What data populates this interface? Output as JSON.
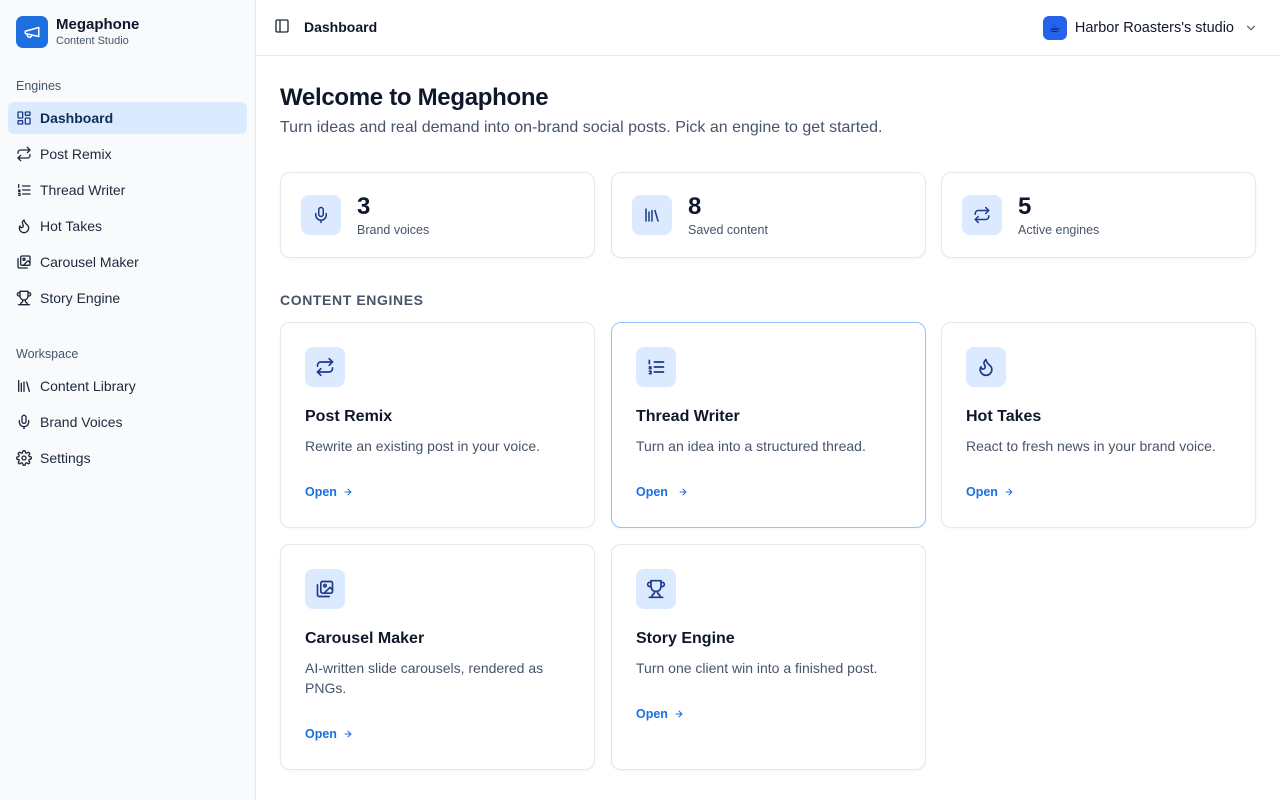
{
  "brand": {
    "name": "Megaphone",
    "subtitle": "Content Studio",
    "logo_icon": "megaphone-icon",
    "color": "#1d6fe0"
  },
  "sidebar": {
    "engines_label": "Engines",
    "engines": [
      {
        "label": "Dashboard",
        "icon": "layout-grid-icon",
        "active": true
      },
      {
        "label": "Post Remix",
        "icon": "repeat-icon"
      },
      {
        "label": "Thread Writer",
        "icon": "list-ordered-icon"
      },
      {
        "label": "Hot Takes",
        "icon": "flame-icon"
      },
      {
        "label": "Carousel Maker",
        "icon": "images-icon"
      },
      {
        "label": "Story Engine",
        "icon": "trophy-icon"
      }
    ],
    "workspace_label": "Workspace",
    "workspace": [
      {
        "label": "Content Library",
        "icon": "library-icon"
      },
      {
        "label": "Brand Voices",
        "icon": "mic-icon"
      },
      {
        "label": "Settings",
        "icon": "gear-icon"
      }
    ]
  },
  "topbar": {
    "title": "Dashboard",
    "studio_name": "Harbor Roasters's studio",
    "studio_avatar": "☕"
  },
  "main": {
    "heading": "Welcome to Megaphone",
    "subheading": "Turn ideas and real demand into on-brand social posts. Pick an engine to get started.",
    "stats": [
      {
        "value": "3",
        "label": "Brand voices",
        "icon": "mic-icon"
      },
      {
        "value": "8",
        "label": "Saved content",
        "icon": "library-icon"
      },
      {
        "value": "5",
        "label": "Active engines",
        "icon": "repeat-icon"
      }
    ],
    "engines_heading": "CONTENT ENGINES",
    "engines": [
      {
        "title": "Post Remix",
        "description": "Rewrite an existing post in your voice.",
        "open_label": "Open",
        "icon": "repeat-icon"
      },
      {
        "title": "Thread Writer",
        "description": "Turn an idea into a structured thread.",
        "open_label": "Open",
        "icon": "list-ordered-icon"
      },
      {
        "title": "Hot Takes",
        "description": "React to fresh news in your brand voice.",
        "open_label": "Open",
        "icon": "flame-icon"
      },
      {
        "title": "Carousel Maker",
        "description": "AI-written slide carousels, rendered as PNGs.",
        "open_label": "Open",
        "icon": "images-icon"
      },
      {
        "title": "Story Engine",
        "description": "Turn one client win into a finished post.",
        "open_label": "Open",
        "icon": "trophy-icon"
      }
    ]
  },
  "colors": {
    "accent": "#1d6fe0",
    "active_bg": "#dbeafe",
    "icon_dark": "#1e3a8a"
  }
}
